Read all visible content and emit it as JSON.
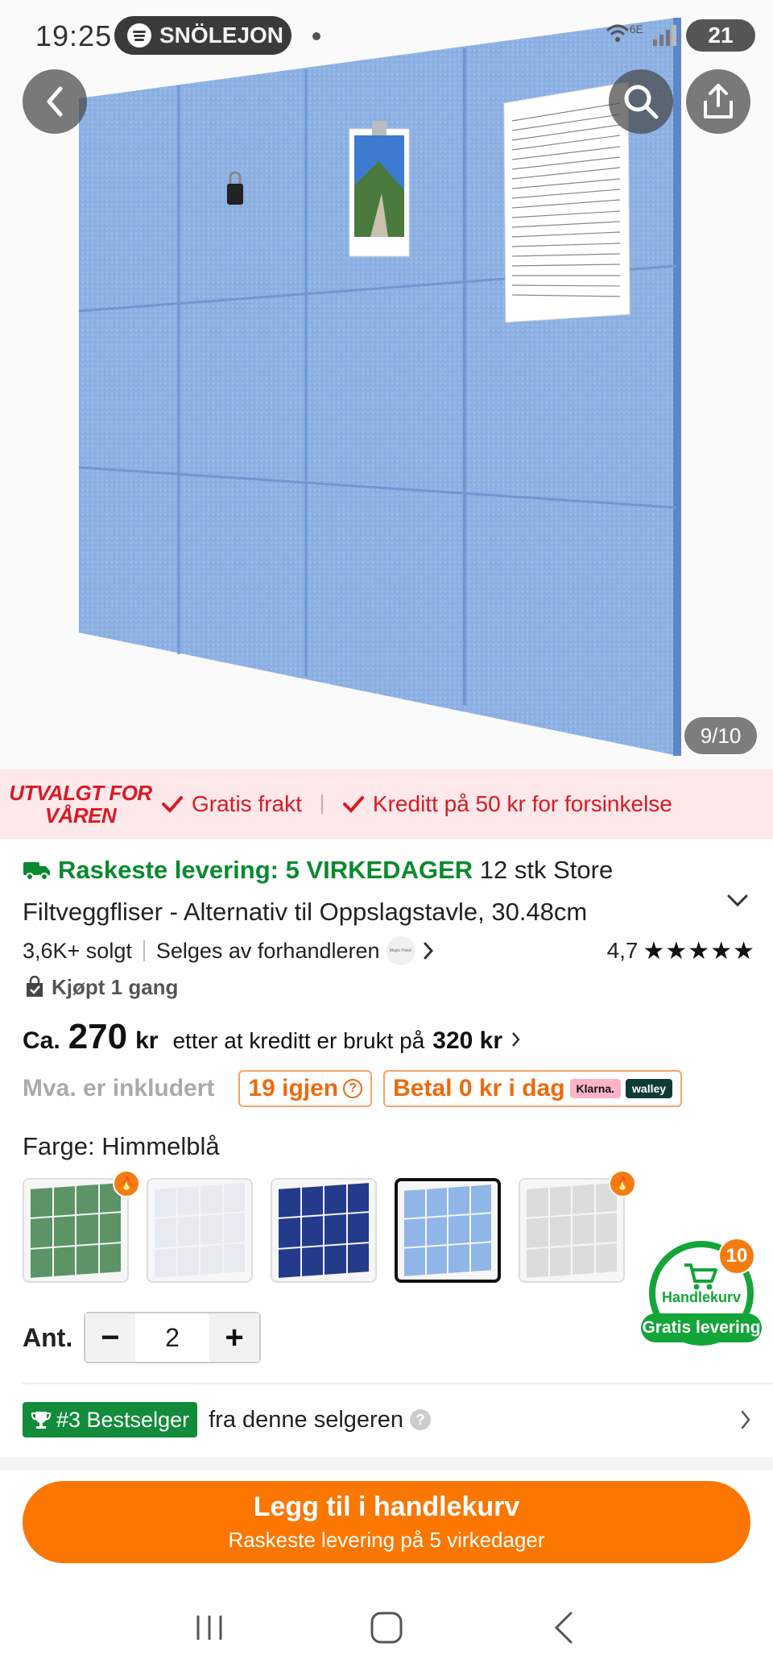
{
  "status_bar": {
    "time": "19:25",
    "media_app": "SNÖLEJON",
    "network": "6E",
    "battery": "21"
  },
  "gallery": {
    "counter": "9/10"
  },
  "promo": {
    "tag_line1": "UTVALGT FOR",
    "tag_line2": "VÅREN",
    "free_shipping": "Gratis frakt",
    "delay_credit": "Kreditt på 50 kr for forsinkelse"
  },
  "product": {
    "fast_delivery": "Raskeste levering: 5 VIRKEDAGER",
    "title": "12 stk Store Filtveggfliser - Alternativ til Oppslagstavle, 30.48cm",
    "sold": "3,6K+ solgt",
    "seller": "Selges av forhandleren",
    "seller_logo_text": "Magic Panel",
    "rating": "4,7",
    "stars": "★★★★★",
    "bought": "Kjøpt 1 gang"
  },
  "price": {
    "prefix": "Ca.",
    "amount": "270",
    "currency": "kr",
    "after_credit": "etter at kreditt er brukt på",
    "original": "320 kr"
  },
  "tax": {
    "vat": "Mva. er inkludert",
    "left": "19 igjen",
    "pay_today": "Betal 0 kr i dag",
    "klarna": "Klarna.",
    "walley": "walley"
  },
  "color": {
    "label": "Farge:",
    "selected": "Himmelblå",
    "options": [
      {
        "name": "green",
        "color": "#5c9467",
        "hot": true
      },
      {
        "name": "white",
        "color": "#e7ebf1",
        "hot": false
      },
      {
        "name": "navy",
        "color": "#243b8c",
        "hot": false
      },
      {
        "name": "sky-blue",
        "color": "#8fb6e6",
        "hot": false
      },
      {
        "name": "light-gray",
        "color": "#dcdcdc",
        "hot": true
      }
    ]
  },
  "quantity": {
    "label": "Ant.",
    "value": "2",
    "minus": "−",
    "plus": "+"
  },
  "cart": {
    "count": "10",
    "label": "Handlekurv",
    "free_delivery": "Gratis levering"
  },
  "bestseller": {
    "badge": "#3 Bestselger",
    "text": "fra denne selgeren"
  },
  "cta": {
    "main": "Legg til i handlekurv",
    "sub": "Raskeste levering på 5 virkedager"
  },
  "colors": {
    "accent": "#fb7701",
    "green": "#0a8a2e",
    "promo_red": "#d81b25",
    "panel_blue": "#8fb0e0"
  }
}
